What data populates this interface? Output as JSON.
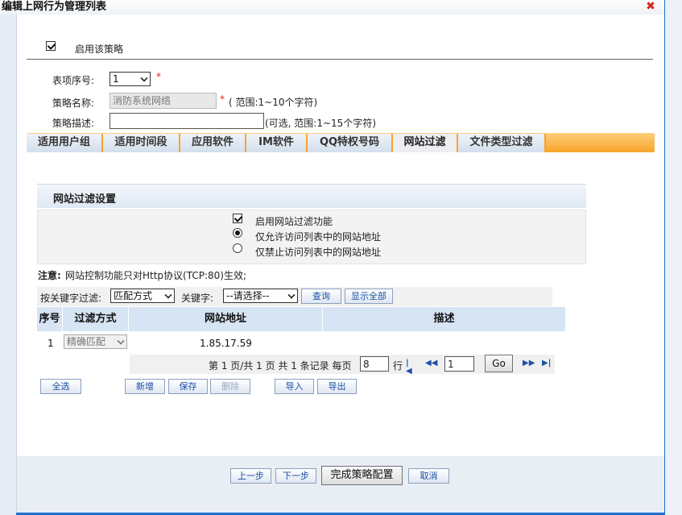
{
  "window": {
    "title": "编辑上网行为管理列表"
  },
  "enable_policy": {
    "label": "启用该策略",
    "checked": true
  },
  "form": {
    "index_label": "表项序号:",
    "index_value": "1",
    "name_label": "策略名称:",
    "name_value": "消防系统网络",
    "name_hint": "( 范围:1~10个字符)",
    "desc_label": "策略描述:",
    "desc_value": "",
    "desc_hint": "(可选, 范围:1~15个字符)",
    "required_mark": "*"
  },
  "tabs": [
    {
      "label": "适用用户组",
      "active": false
    },
    {
      "label": "适用时间段",
      "active": false
    },
    {
      "label": "应用软件",
      "active": false
    },
    {
      "label": "IM软件",
      "active": false
    },
    {
      "label": "QQ特权号码",
      "active": false
    },
    {
      "label": "网站过滤",
      "active": true
    },
    {
      "label": "文件类型过滤",
      "active": false
    }
  ],
  "section": {
    "title": "网站过滤设置",
    "enable_filter": "启用网站过滤功能",
    "allow_only": "仅允许访问列表中的网站地址",
    "deny_only": "仅禁止访问列表中的网站地址",
    "note_prefix": "注意:",
    "note_text": "网站控制功能只对Http协议(TCP:80)生效;"
  },
  "filter": {
    "keyword_filter_label": "按关键字过滤:",
    "match_mode": "匹配方式",
    "keyword_label": "关键字:",
    "keyword_select": "--请选择--",
    "query_button": "查询",
    "show_all_button": "显示全部"
  },
  "table": {
    "headers": [
      "序号",
      "过滤方式",
      "网站地址",
      "描述"
    ],
    "rows": [
      {
        "index": "1",
        "mode": "精确匹配",
        "url": "1.85.17.59",
        "desc": ""
      }
    ]
  },
  "pager": {
    "summary": "第 1 页/共 1 页 共 1 条记录 每页",
    "per_page": "8",
    "rows_unit": "行",
    "page_input": "1",
    "go_button": "Go"
  },
  "actions": {
    "select_all": "全选",
    "add": "新增",
    "save": "保存",
    "delete": "删除",
    "import": "导入",
    "export": "导出"
  },
  "footer": {
    "prev": "上一步",
    "next": "下一步",
    "finish": "完成策略配置",
    "cancel": "取消"
  },
  "colors": {
    "accent": "#1f6fcf",
    "tab_bar": "#f7a42a",
    "required": "#e0231b"
  }
}
